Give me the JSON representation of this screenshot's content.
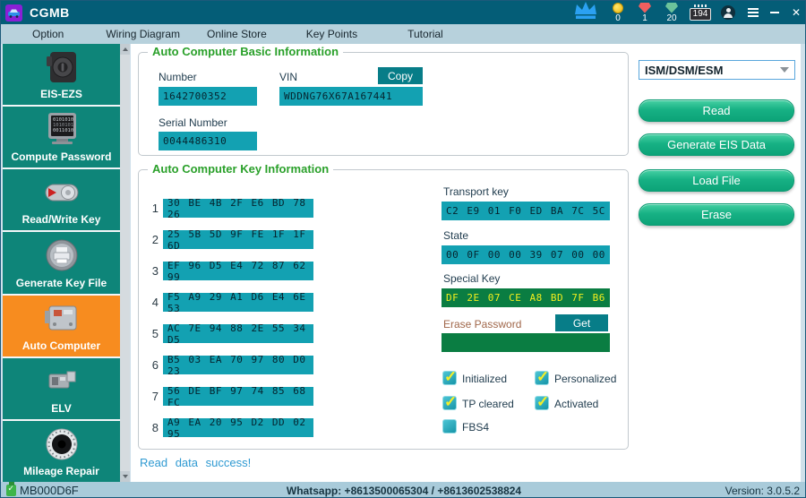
{
  "titlebar": {
    "title": "CGMB",
    "counters": {
      "coins": "0",
      "rubies": "1",
      "emeralds": "20",
      "points": "194"
    },
    "icons": {
      "close_glyph": "✕"
    }
  },
  "menu": {
    "items": [
      "Option",
      "Wiring Diagram",
      "Online Store",
      "Key Points",
      "Tutorial"
    ]
  },
  "sidebar": {
    "items": [
      {
        "label": "EIS-EZS",
        "selected": false
      },
      {
        "label": "Compute Password",
        "selected": false
      },
      {
        "label": "Read/Write Key",
        "selected": false
      },
      {
        "label": "Generate Key File",
        "selected": false
      },
      {
        "label": "Auto Computer",
        "selected": true
      },
      {
        "label": "ELV",
        "selected": false
      },
      {
        "label": "Mileage Repair",
        "selected": false
      }
    ]
  },
  "basic_info": {
    "title": "Auto Computer Basic Information",
    "number_label": "Number",
    "number_value": "1642700352",
    "vin_label": "VIN",
    "vin_value": "WDDNG76X67A167441",
    "copy_button": "Copy",
    "serial_label": "Serial Number",
    "serial_value": "0044486310"
  },
  "key_info": {
    "title": "Auto Computer Key Information",
    "rows": [
      {
        "index": "1",
        "value": "30 BE 4B 2F E6 BD 78 26"
      },
      {
        "index": "2",
        "value": "25 5B 5D 9F FE 1F 1F 6D"
      },
      {
        "index": "3",
        "value": "EF 96 D5 E4 72 87 62 99"
      },
      {
        "index": "4",
        "value": "F5 A9 29 A1 D6 E4 6E 53"
      },
      {
        "index": "5",
        "value": "AC 7E 94 88 2E 55 34 D5"
      },
      {
        "index": "6",
        "value": "B5 03 EA 70 97 80 D0 23"
      },
      {
        "index": "7",
        "value": "56 DE BF 97 74 85 68 FC"
      },
      {
        "index": "8",
        "value": "A9 EA 20 95 D2 DD 02 95"
      }
    ],
    "transport_key": {
      "label": "Transport key",
      "value": "C2 E9 01 F0 ED BA 7C 5C"
    },
    "state": {
      "label": "State",
      "value": "00 0F 00 00 39 07 00 00"
    },
    "special_key": {
      "label": "Special Key",
      "value": "DF 2E 07 CE A8 BD 7F B6"
    },
    "erase_password": {
      "label": "Erase Password",
      "button": "Get",
      "value": ""
    },
    "checkboxes": [
      {
        "label": "Initialized",
        "checked": true
      },
      {
        "label": "Personalized",
        "checked": true
      },
      {
        "label": "TP cleared",
        "checked": true
      },
      {
        "label": "Activated",
        "checked": true
      },
      {
        "label": "FBS4",
        "checked": false
      }
    ]
  },
  "right_panel": {
    "selected_module": "ISM/DSM/ESM",
    "buttons": [
      "Read",
      "Generate EIS Data",
      "Load File",
      "Erase"
    ]
  },
  "status": {
    "message": "Read data success!",
    "device_id": "MB000D6F",
    "whatsapp": "Whatsapp: +8613500065304 / +8613602538824",
    "version": "Version: 3.0.5.2"
  },
  "colors": {
    "titlebar": "#045d77",
    "menubar": "#b7d1dc",
    "sidebar_item": "#0e8579",
    "sidebar_selected": "#f78c1f",
    "field_bg": "#13a1b2",
    "special_field_bg": "#0a7d42",
    "special_field_text": "#f2ee1e",
    "action_button": "#14ad81",
    "group_title": "#2aa02a",
    "status_bar": "#a9cbda",
    "message_text": "#2f9ad2"
  }
}
